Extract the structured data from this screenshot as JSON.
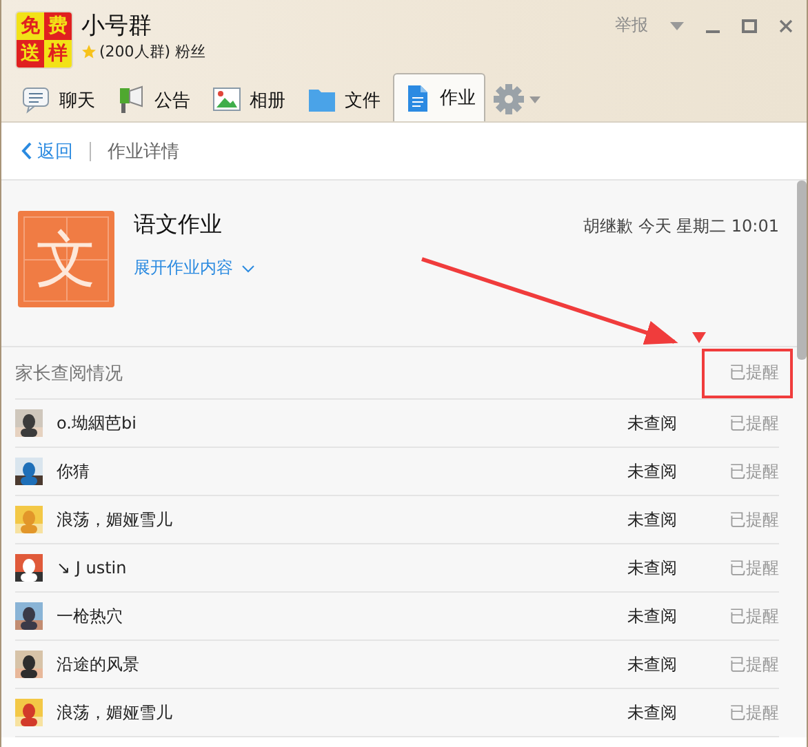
{
  "window": {
    "group_name": "小号群",
    "group_logo": [
      "免",
      "费",
      "送",
      "样"
    ],
    "starred": true,
    "group_info": "(200人群) 粉丝",
    "report": "举报"
  },
  "tabs": [
    {
      "label": "聊天",
      "kind": "chat",
      "selected": false
    },
    {
      "label": "公告",
      "kind": "notice",
      "selected": false
    },
    {
      "label": "相册",
      "kind": "album",
      "selected": false
    },
    {
      "label": "文件",
      "kind": "file",
      "selected": false
    },
    {
      "label": "作业",
      "kind": "homework",
      "selected": true
    }
  ],
  "nav": {
    "back": "返回",
    "title": "作业详情"
  },
  "assignment": {
    "subject_glyph": "文",
    "title": "语文作业",
    "meta": "胡继歉 今天 星期二 10:01",
    "expand": "展开作业内容"
  },
  "section": {
    "title": "家长查阅情况",
    "action": "已提醒"
  },
  "parents": [
    {
      "name": "o.坳絪芭bi",
      "status": "未查阅",
      "reminder": "已提醒"
    },
    {
      "name": "你猜",
      "status": "未查阅",
      "reminder": "已提醒"
    },
    {
      "name": "浪荡，媚娅雪儿",
      "status": "未查阅",
      "reminder": "已提醒"
    },
    {
      "name": "↘ J ustin",
      "status": "未查阅",
      "reminder": "已提醒"
    },
    {
      "name": "一枪热穴",
      "status": "未查阅",
      "reminder": "已提醒"
    },
    {
      "name": "沿途的风景",
      "status": "未查阅",
      "reminder": "已提醒"
    },
    {
      "name": "浪荡，媚娅雪儿",
      "status": "未查阅",
      "reminder": "已提醒"
    }
  ]
}
